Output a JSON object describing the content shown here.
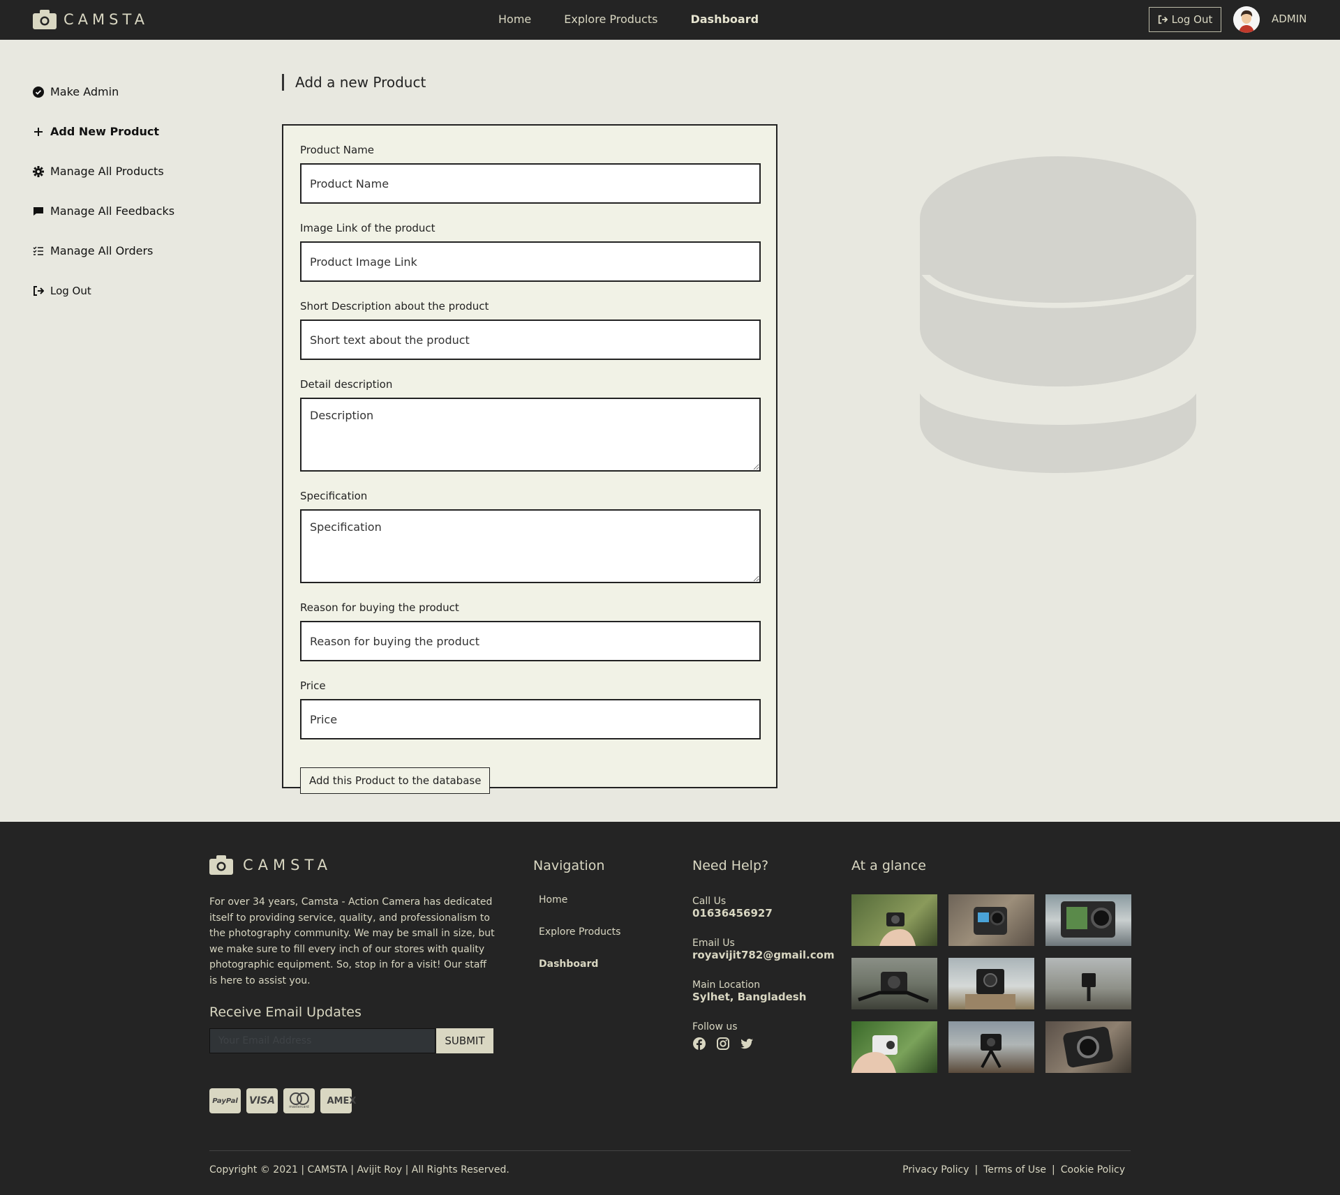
{
  "brand": {
    "name": "CAMSTA"
  },
  "navbar": {
    "links": [
      "Home",
      "Explore Products",
      "Dashboard"
    ],
    "logout_label": "Log Out",
    "user_label": "ADMIN"
  },
  "sidebar": {
    "items": [
      {
        "label": "Make Admin",
        "icon": "check-circle-icon"
      },
      {
        "label": "Add New Product",
        "icon": "plus-icon"
      },
      {
        "label": "Manage All Products",
        "icon": "gear-icon"
      },
      {
        "label": "Manage All Feedbacks",
        "icon": "comment-icon"
      },
      {
        "label": "Manage All Orders",
        "icon": "list-check-icon"
      },
      {
        "label": "Log Out",
        "icon": "sign-out-icon"
      }
    ]
  },
  "main": {
    "title": "Add a new Product",
    "form": {
      "fields": [
        {
          "label": "Product Name",
          "placeholder": "Product Name"
        },
        {
          "label": "Image Link of the product",
          "placeholder": "Product Image Link"
        },
        {
          "label": "Short Description about the product",
          "placeholder": "Short text about the product"
        },
        {
          "label": "Detail description",
          "placeholder": "Description"
        },
        {
          "label": "Specification",
          "placeholder": "Specification"
        },
        {
          "label": "Reason for buying the product",
          "placeholder": "Reason for buying the product"
        },
        {
          "label": "Price",
          "placeholder": "Price"
        }
      ],
      "submit_label": "Add this Product to the database"
    }
  },
  "footer": {
    "about": "For over 34 years, Camsta - Action Camera has dedicated itself to providing service, quality, and professionalism to the photography community. We may be small in size, but we make sure to fill every inch of our stores with quality photographic equipment. So, stop in for a visit! Our staff is here to assist you.",
    "subscribe_title": "Receive Email Updates",
    "email_placeholder": "Your Email Address",
    "submit_label": "SUBMIT",
    "payments": [
      "PayPal",
      "VISA",
      "mastercard",
      "AMEX"
    ],
    "nav_title": "Navigation",
    "nav_links": [
      "Home",
      "Explore Products",
      "Dashboard"
    ],
    "help_title": "Need Help?",
    "call_label": "Call Us",
    "call_value": "01636456927",
    "email_label": "Email Us",
    "email_value": "royavijit782@gmail.com",
    "location_label": "Main Location",
    "location_value": "Sylhet, Bangladesh",
    "follow_label": "Follow us",
    "social_icons": [
      "facebook-icon",
      "instagram-icon",
      "twitter-icon"
    ],
    "glance_title": "At a glance",
    "copyright": "Copyright © 2021 | CAMSTA | Avijit Roy | All Rights Reserved.",
    "legal_links": [
      "Privacy Policy",
      "Terms of Use",
      "Cookie Policy"
    ]
  },
  "colors": {
    "nav_bg": "#242424",
    "accent": "#d9d7c2",
    "page_bg": "#e8e8e0",
    "form_bg": "#f1f2e6"
  }
}
